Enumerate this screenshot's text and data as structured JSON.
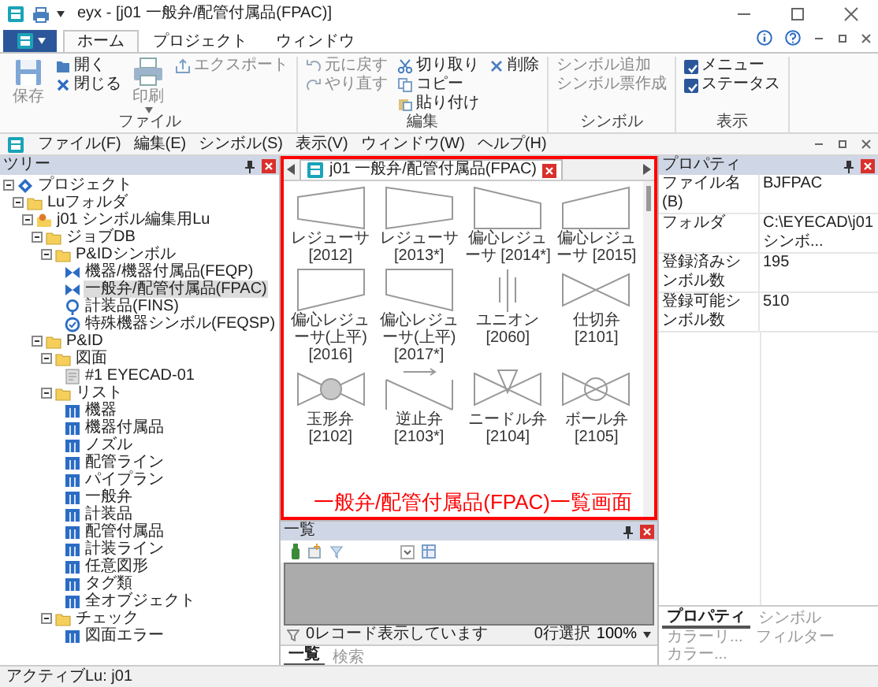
{
  "window": {
    "title": "eyx - [j01 一般弁/配管付属品(FPAC)]"
  },
  "ribbon": {
    "tabs": [
      {
        "label": "ホーム",
        "selected": true
      },
      {
        "label": "プロジェクト",
        "selected": false
      },
      {
        "label": "ウィンドウ",
        "selected": false
      }
    ],
    "groups": [
      {
        "label": "ファイル",
        "columns": [
          [
            {
              "kind": "large",
              "label": "保存",
              "disabled": true
            }
          ],
          [
            {
              "kind": "small",
              "label": "開く",
              "disabled": false
            },
            {
              "kind": "small",
              "label": "閉じる",
              "disabled": false
            }
          ],
          [
            {
              "kind": "large",
              "label": "印刷",
              "disabled": true,
              "dropdown": true
            }
          ],
          [
            {
              "kind": "small",
              "label": "エクスポート",
              "disabled": true
            }
          ]
        ]
      },
      {
        "label": "編集",
        "columns": [
          [
            {
              "kind": "small",
              "label": "元に戻す",
              "disabled": true
            },
            {
              "kind": "small",
              "label": "やり直す",
              "disabled": true
            }
          ],
          [
            {
              "kind": "small",
              "label": "切り取り",
              "disabled": false
            },
            {
              "kind": "small",
              "label": "コピー",
              "disabled": false
            },
            {
              "kind": "small",
              "label": "貼り付け",
              "disabled": false
            }
          ],
          [
            {
              "kind": "small",
              "label": "削除",
              "disabled": false
            }
          ]
        ]
      },
      {
        "label": "シンボル",
        "columns": [
          [
            {
              "kind": "small",
              "label": "シンボル追加",
              "disabled": true
            },
            {
              "kind": "small",
              "label": "シンボル票作成",
              "disabled": true
            }
          ]
        ]
      },
      {
        "label": "表示",
        "columns": [
          [
            {
              "kind": "check",
              "label": "メニュー",
              "checked": true
            },
            {
              "kind": "check",
              "label": "ステータス",
              "checked": true
            }
          ]
        ]
      }
    ]
  },
  "menu": [
    "ファイル(F)",
    "編集(E)",
    "シンボル(S)",
    "表示(V)",
    "ウィンドウ(W)",
    "ヘルプ(H)"
  ],
  "tree": {
    "title": "ツリー",
    "items": [
      {
        "label": "プロジェクト",
        "kind": "project",
        "expanded": true,
        "selected": false,
        "children": [
          {
            "label": "Luフォルダ",
            "kind": "folder",
            "expanded": true,
            "selected": false,
            "children": [
              {
                "label": "j01 シンボル編集用Lu",
                "kind": "lu",
                "expanded": true,
                "selected": false,
                "children": [
                  {
                    "label": "ジョブDB",
                    "kind": "folder",
                    "expanded": true,
                    "selected": false,
                    "children": [
                      {
                        "label": "P&IDシンボル",
                        "kind": "folder",
                        "expanded": true,
                        "selected": false,
                        "children": [
                          {
                            "label": "機器/機器付属品(FEQP)",
                            "kind": "symbol",
                            "selected": false
                          },
                          {
                            "label": "一般弁/配管付属品(FPAC)",
                            "kind": "symbol",
                            "selected": true
                          },
                          {
                            "label": "計装品(FINS)",
                            "kind": "instrument",
                            "selected": false
                          },
                          {
                            "label": "特殊機器シンボル(FEQSP)",
                            "kind": "special",
                            "selected": false
                          }
                        ]
                      }
                    ]
                  },
                  {
                    "label": "P&ID",
                    "kind": "folder",
                    "expanded": true,
                    "selected": false,
                    "children": [
                      {
                        "label": "図面",
                        "kind": "folder",
                        "expanded": true,
                        "selected": false,
                        "children": [
                          {
                            "label": "#1 EYECAD-01",
                            "kind": "drawing",
                            "selected": false
                          }
                        ]
                      },
                      {
                        "label": "リスト",
                        "kind": "folder",
                        "expanded": true,
                        "selected": false,
                        "children": [
                          {
                            "label": "機器",
                            "kind": "list",
                            "selected": false
                          },
                          {
                            "label": "機器付属品",
                            "kind": "list",
                            "selected": false
                          },
                          {
                            "label": "ノズル",
                            "kind": "list",
                            "selected": false
                          },
                          {
                            "label": "配管ライン",
                            "kind": "list",
                            "selected": false
                          },
                          {
                            "label": "パイプラン",
                            "kind": "list",
                            "selected": false
                          },
                          {
                            "label": "一般弁",
                            "kind": "list",
                            "selected": false
                          },
                          {
                            "label": "計装品",
                            "kind": "list",
                            "selected": false
                          },
                          {
                            "label": "配管付属品",
                            "kind": "list",
                            "selected": false
                          },
                          {
                            "label": "計装ライン",
                            "kind": "list",
                            "selected": false
                          },
                          {
                            "label": "任意図形",
                            "kind": "list",
                            "selected": false
                          },
                          {
                            "label": "タグ類",
                            "kind": "list",
                            "selected": false
                          },
                          {
                            "label": "全オブジェクト",
                            "kind": "list",
                            "selected": false
                          }
                        ]
                      },
                      {
                        "label": "チェック",
                        "kind": "folder",
                        "expanded": true,
                        "selected": false,
                        "children": [
                          {
                            "label": "図面エラー",
                            "kind": "list",
                            "selected": false
                          }
                        ]
                      }
                    ]
                  }
                ]
              }
            ]
          }
        ]
      }
    ]
  },
  "document": {
    "tab": {
      "label": "j01 一般弁/配管付属品(FPAC)",
      "selected": true
    },
    "symbols": [
      {
        "kind": "reducer-up",
        "label": "レジューサ [2012]"
      },
      {
        "kind": "reducer-down",
        "label": "レジューサ [2013*]"
      },
      {
        "kind": "ecc-down",
        "label": "偏心レジューサ [2014*]"
      },
      {
        "kind": "ecc-up",
        "label": "偏心レジューサ [2015]"
      },
      {
        "kind": "ecc-top-down",
        "label": "偏心レジューサ(上平) [2016]"
      },
      {
        "kind": "ecc-top-up",
        "label": "偏心レジューサ(上平) [2017*]"
      },
      {
        "kind": "union",
        "label": "ユニオン [2060]"
      },
      {
        "kind": "gate",
        "label": "仕切弁 [2101]"
      },
      {
        "kind": "globe",
        "label": "玉形弁 [2102]"
      },
      {
        "kind": "check",
        "label": "逆止弁 [2103*]"
      },
      {
        "kind": "needle",
        "label": "ニードル弁 [2104]"
      },
      {
        "kind": "ball",
        "label": "ボール弁 [2105]"
      }
    ],
    "annotation": "一般弁/配管付属品(FPAC)一覧画面"
  },
  "list_panel": {
    "title": "一覧",
    "status": "0レコード表示しています",
    "selection": "0行選択",
    "zoom": "100%",
    "tabs": [
      {
        "label": "一覧",
        "selected": true
      },
      {
        "label": "検索",
        "selected": false
      }
    ]
  },
  "properties": {
    "title": "プロパティ",
    "rows": [
      {
        "name": "ファイル名(B)",
        "value": "BJFPAC"
      },
      {
        "name": "フォルダ",
        "value": "C:\\EYECAD\\j01 シンボ..."
      },
      {
        "name": "登録済みシンボル数",
        "value": "195"
      },
      {
        "name": "登録可能シンボル数",
        "value": "510"
      }
    ],
    "tabs": [
      {
        "label": "プロパティ",
        "selected": true
      },
      {
        "label": "シンボル",
        "selected": false
      },
      {
        "label": "カラーリ...",
        "selected": false
      },
      {
        "label": "フィルター",
        "selected": false
      },
      {
        "label": "カラー...",
        "selected": false
      }
    ]
  },
  "status_bar": "アクティブLu: j01"
}
